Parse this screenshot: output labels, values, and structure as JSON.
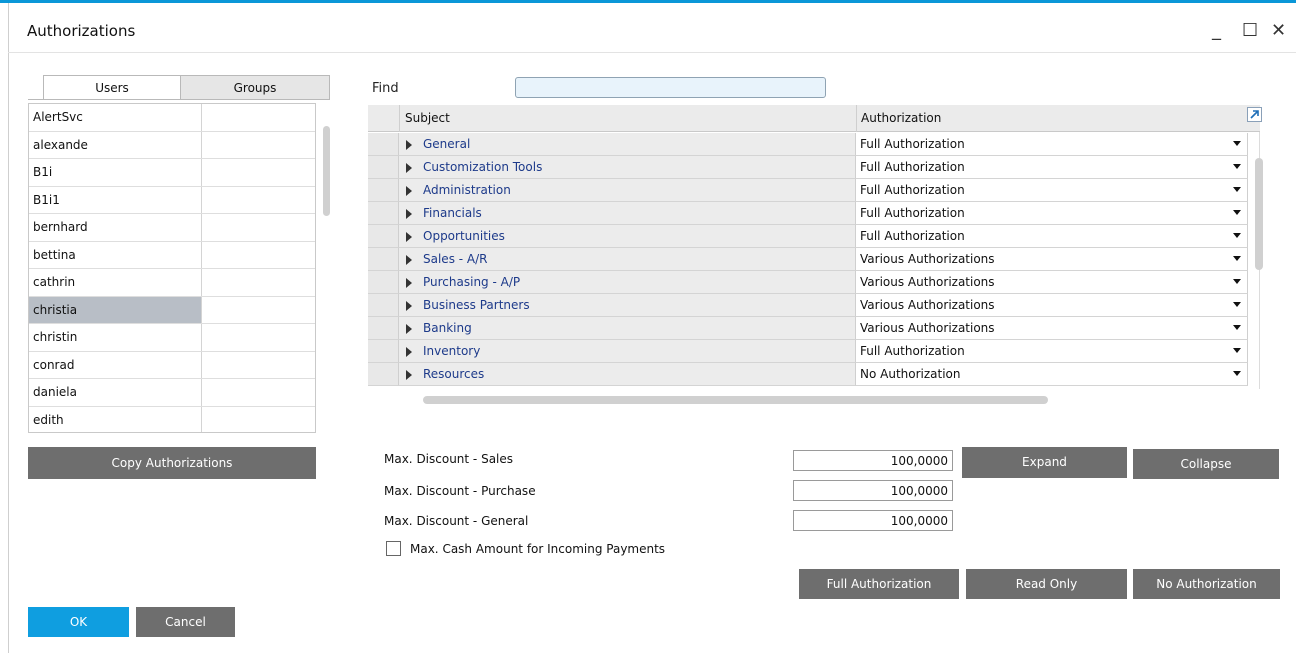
{
  "window": {
    "title": "Authorizations",
    "minimize_glyph": "_",
    "maximize_glyph": "☐",
    "close_glyph": "✕",
    "accent": "#0a97d8"
  },
  "tabs": [
    {
      "label": "Users",
      "active": true
    },
    {
      "label": "Groups",
      "active": false
    }
  ],
  "users": [
    "AlertSvc",
    "alexande",
    "B1i",
    "B1i1",
    "bernhard",
    "bettina",
    "cathrin",
    "christia",
    "christin",
    "conrad",
    "daniela",
    "edith"
  ],
  "selected_user": "christia",
  "copy_button": "Copy Authorizations",
  "find": {
    "label": "Find",
    "value": ""
  },
  "grid": {
    "columns": [
      "Subject",
      "Authorization"
    ],
    "rows": [
      {
        "subject": "General",
        "authorization": "Full Authorization"
      },
      {
        "subject": "Customization Tools",
        "authorization": "Full Authorization"
      },
      {
        "subject": "Administration",
        "authorization": "Full Authorization"
      },
      {
        "subject": "Financials",
        "authorization": "Full Authorization"
      },
      {
        "subject": "Opportunities",
        "authorization": "Full Authorization"
      },
      {
        "subject": "Sales - A/R",
        "authorization": "Various Authorizations"
      },
      {
        "subject": "Purchasing - A/P",
        "authorization": "Various Authorizations"
      },
      {
        "subject": "Business Partners",
        "authorization": "Various Authorizations"
      },
      {
        "subject": "Banking",
        "authorization": "Various Authorizations"
      },
      {
        "subject": "Inventory",
        "authorization": "Full Authorization"
      },
      {
        "subject": "Resources",
        "authorization": "No Authorization"
      }
    ]
  },
  "discounts": [
    {
      "label": "Max. Discount - Sales",
      "value": "100,0000"
    },
    {
      "label": "Max. Discount - Purchase",
      "value": "100,0000"
    },
    {
      "label": "Max. Discount - General",
      "value": "100,0000"
    }
  ],
  "cash_checkbox": {
    "label": "Max. Cash Amount for Incoming Payments",
    "checked": false
  },
  "buttons": {
    "expand": "Expand",
    "collapse": "Collapse",
    "full": "Full Authorization",
    "read_only": "Read Only",
    "none": "No Authorization",
    "ok": "OK",
    "cancel": "Cancel"
  },
  "colors": {
    "ok_button": "#0f9ee0",
    "gray_button": "#6e6e6e",
    "selection": "#b8bec6",
    "subject_link": "#1d3a8a"
  }
}
